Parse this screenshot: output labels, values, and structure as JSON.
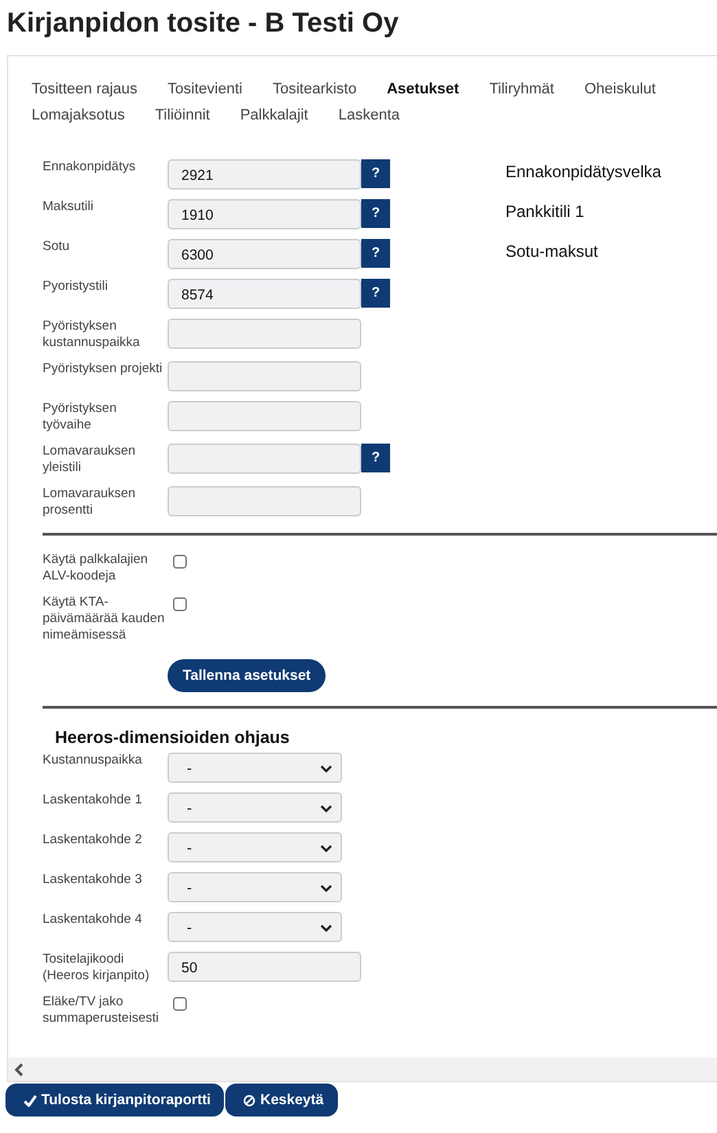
{
  "title": "Kirjanpidon tosite - B Testi Oy",
  "tabs": [
    {
      "label": "Tositteen rajaus",
      "selected": false
    },
    {
      "label": "Tositevienti",
      "selected": false
    },
    {
      "label": "Tositearkisto",
      "selected": false
    },
    {
      "label": "Asetukset",
      "selected": true
    },
    {
      "label": "Tiliryhmät",
      "selected": false
    },
    {
      "label": "Oheiskulut",
      "selected": false
    },
    {
      "label": "Lomajaksotus",
      "selected": false
    },
    {
      "label": "Tiliöinnit",
      "selected": false
    },
    {
      "label": "Palkkalajit",
      "selected": false
    },
    {
      "label": "Laskenta",
      "selected": false
    }
  ],
  "account_fields": [
    {
      "kind": "text",
      "label": "Ennakonpidätys",
      "value": "2921",
      "help": "?"
    },
    {
      "kind": "text",
      "label": "Maksutili",
      "value": "1910",
      "help": "?"
    },
    {
      "kind": "text",
      "label": "Sotu",
      "value": "6300",
      "help": "?"
    },
    {
      "kind": "text",
      "label": "Pyoristystili",
      "value": "8574",
      "help": "?"
    },
    {
      "kind": "text",
      "label": "Pyöristyksen kustannuspaikka"
    },
    {
      "kind": "text",
      "label": "Pyöristyksen projekti"
    },
    {
      "kind": "text",
      "label": "Pyöristyksen työvaihe"
    },
    {
      "kind": "text",
      "label": "Lomavarauksen yleistili",
      "help": "?"
    },
    {
      "kind": "text",
      "label": "Lomavarauksen prosentti"
    }
  ],
  "account_names": [
    "Ennakonpidätysvelka",
    "Pankkitili 1",
    "Sotu-maksut"
  ],
  "option_fields": [
    {
      "kind": "checkbox",
      "label": "Käytä palkkalajien ALV-koodeja",
      "checked": false
    },
    {
      "kind": "checkbox",
      "label": "Käytä KTA-päivämäärää kauden nimeämisessä",
      "checked": false
    }
  ],
  "save_button": "Tallenna asetukset",
  "dimension_heading": "Heeros-dimensioiden ohjaus",
  "dimension_fields": [
    {
      "kind": "select",
      "label": "Kustannuspaikka",
      "value": "-"
    },
    {
      "kind": "select",
      "label": "Laskentakohde 1",
      "value": "-"
    },
    {
      "kind": "select",
      "label": "Laskentakohde 2",
      "value": "-"
    },
    {
      "kind": "select",
      "label": "Laskentakohde 3",
      "value": "-"
    },
    {
      "kind": "select",
      "label": "Laskentakohde 4",
      "value": "-"
    },
    {
      "kind": "text",
      "label": "Tositelajikoodi (Heeros kirjanpito)",
      "value": "50"
    },
    {
      "kind": "checkbox",
      "label": "Eläke/TV jako summaperusteisesti",
      "checked": false
    }
  ],
  "footer_buttons": [
    {
      "kind": "confirm",
      "label": "Tulosta kirjanpitoraportti"
    },
    {
      "kind": "cancel",
      "label": "Keskeytä"
    }
  ]
}
